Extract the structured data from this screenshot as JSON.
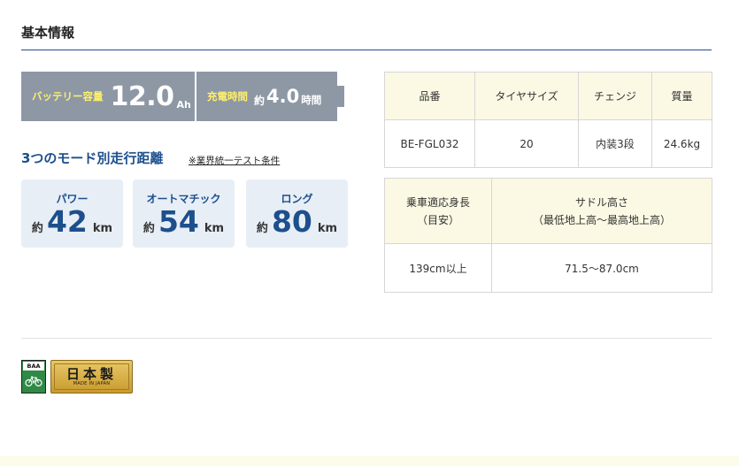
{
  "section": {
    "title": "基本情報"
  },
  "battery": {
    "capacity_label": "バッテリー容量",
    "capacity_value": "12.0",
    "capacity_unit": "Ah",
    "charge_label": "充電時間",
    "charge_prefix": "約",
    "charge_value": "4.0",
    "charge_unit": "時間"
  },
  "modes": {
    "heading": "3つのモード別走行距離",
    "note": "※業界統一テスト条件",
    "items": [
      {
        "name": "パワー",
        "prefix": "約",
        "value": "42",
        "unit": "km"
      },
      {
        "name": "オートマチック",
        "prefix": "約",
        "value": "54",
        "unit": "km"
      },
      {
        "name": "ロング",
        "prefix": "約",
        "value": "80",
        "unit": "km"
      }
    ]
  },
  "spec_table_1": {
    "headers": [
      "品番",
      "タイヤサイズ",
      "チェンジ",
      "質量"
    ],
    "row": [
      "BE-FGL032",
      "20",
      "内装3段",
      "24.6kg"
    ]
  },
  "spec_table_2": {
    "header_1_line1": "乗車適応身長",
    "header_1_line2": "（目安）",
    "header_2_line1": "サドル高さ",
    "header_2_line2": "（最低地上高〜最高地上高）",
    "row": [
      "139cm以上",
      "71.5〜87.0cm"
    ]
  },
  "badges": {
    "baa_text": "BAA",
    "made_in_japan_main": "日本製",
    "made_in_japan_sub": "MADE IN JAPAN"
  },
  "colors": {
    "accent_blue": "#1d4f8c",
    "banner_gray": "#8e98a5",
    "banner_label_yellow": "#fff06a",
    "card_bg": "#e7eef6",
    "table_header_bg": "#fbf9e4"
  }
}
